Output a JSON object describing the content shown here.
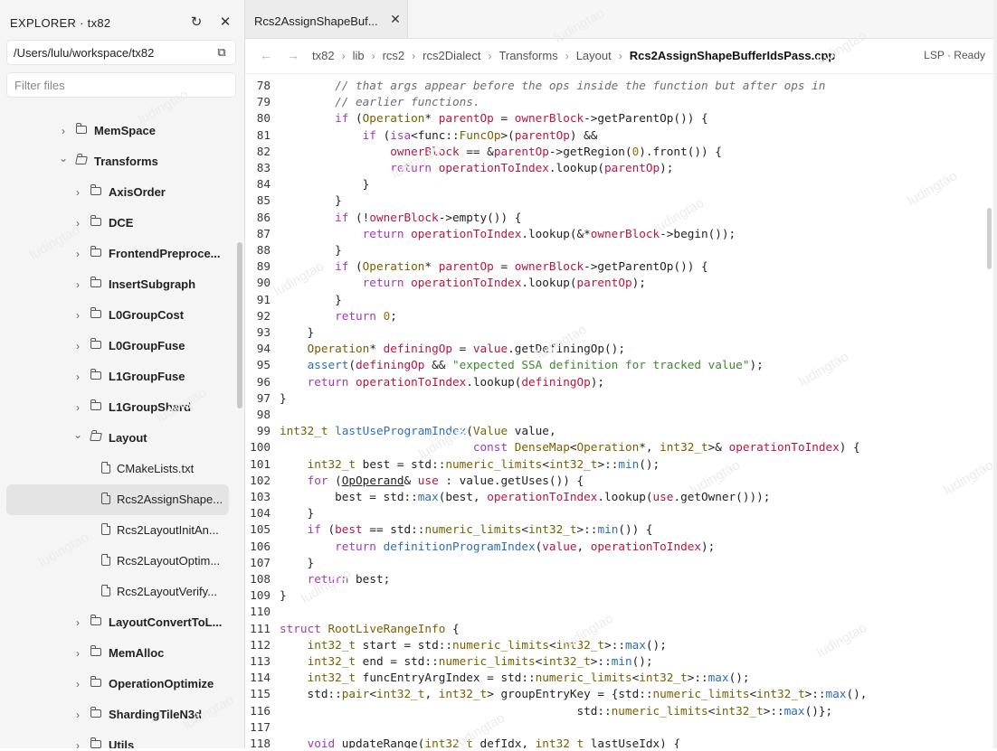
{
  "sidebar": {
    "title": "EXPLORER · tx82",
    "refresh_icon": "refresh-icon",
    "close_icon": "close-icon",
    "path": "/Users/lulu/workspace/tx82",
    "copy_icon": "copy-icon",
    "filter_placeholder": "Filter files",
    "tree": [
      {
        "name": "MemSpace",
        "kind": "folder",
        "expanded": false,
        "bold": true
      },
      {
        "name": "Transforms",
        "kind": "folder",
        "expanded": true,
        "bold": true
      },
      {
        "name": "AxisOrder",
        "kind": "folder",
        "expanded": false,
        "bold": true
      },
      {
        "name": "DCE",
        "kind": "folder",
        "expanded": false,
        "bold": true
      },
      {
        "name": "FrontendPreproce...",
        "kind": "folder",
        "expanded": false,
        "bold": true
      },
      {
        "name": "InsertSubgraph",
        "kind": "folder",
        "expanded": false,
        "bold": true
      },
      {
        "name": "L0GroupCost",
        "kind": "folder",
        "expanded": false,
        "bold": true
      },
      {
        "name": "L0GroupFuse",
        "kind": "folder",
        "expanded": false,
        "bold": true
      },
      {
        "name": "L1GroupFuse",
        "kind": "folder",
        "expanded": false,
        "bold": true
      },
      {
        "name": "L1GroupShard",
        "kind": "folder",
        "expanded": false,
        "bold": true
      },
      {
        "name": "Layout",
        "kind": "folder",
        "expanded": true,
        "bold": true
      },
      {
        "name": "CMakeLists.txt",
        "kind": "file",
        "bold": false
      },
      {
        "name": "Rcs2AssignShape...",
        "kind": "file",
        "bold": false,
        "selected": true
      },
      {
        "name": "Rcs2LayoutInitAn...",
        "kind": "file",
        "bold": false
      },
      {
        "name": "Rcs2LayoutOptim...",
        "kind": "file",
        "bold": false
      },
      {
        "name": "Rcs2LayoutVerify...",
        "kind": "file",
        "bold": false
      },
      {
        "name": "LayoutConvertToL...",
        "kind": "folder",
        "expanded": false,
        "bold": true
      },
      {
        "name": "MemAlloc",
        "kind": "folder",
        "expanded": false,
        "bold": true
      },
      {
        "name": "OperationOptimize",
        "kind": "folder",
        "expanded": false,
        "bold": true
      },
      {
        "name": "ShardingTileN3d",
        "kind": "folder",
        "expanded": false,
        "bold": true
      },
      {
        "name": "Utils",
        "kind": "folder",
        "expanded": false,
        "bold": true
      }
    ]
  },
  "editor": {
    "tab_label": "Rcs2AssignShapeBuf...",
    "tab_close_icon": "close-icon",
    "back_icon": "arrow-left-icon",
    "forward_icon": "arrow-right-icon",
    "breadcrumb": [
      "tx82",
      "lib",
      "rcs2",
      "rcs2Dialect",
      "Transforms",
      "Layout",
      "Rcs2AssignShapeBufferIdsPass.cpp"
    ],
    "lsp_status": "LSP · Ready",
    "lines": [
      {
        "n": "78",
        "s": [
          [
            "        ",
            ""
          ],
          [
            "// that args appear before the ops inside the function but after ops in",
            "cm"
          ]
        ]
      },
      {
        "n": "79",
        "s": [
          [
            "        ",
            ""
          ],
          [
            "// earlier functions.",
            "cm"
          ]
        ]
      },
      {
        "n": "80",
        "s": [
          [
            "        ",
            ""
          ],
          [
            "if",
            "kw"
          ],
          [
            " (",
            ""
          ],
          [
            "Operation",
            "ty"
          ],
          [
            "* ",
            ""
          ],
          [
            "parentOp",
            "id"
          ],
          [
            " = ",
            ""
          ],
          [
            "ownerBlock",
            "id"
          ],
          [
            "->getParentOp()) {",
            ""
          ]
        ]
      },
      {
        "n": "81",
        "s": [
          [
            "            ",
            ""
          ],
          [
            "if",
            "kw"
          ],
          [
            " (",
            ""
          ],
          [
            "isa",
            "kw"
          ],
          [
            "<func::",
            ""
          ],
          [
            "FuncOp",
            "ty"
          ],
          [
            ">(",
            ""
          ],
          [
            "parentOp",
            "id"
          ],
          [
            ") &&",
            ""
          ]
        ]
      },
      {
        "n": "82",
        "s": [
          [
            "                ",
            ""
          ],
          [
            "ownerBlock",
            "id"
          ],
          [
            " == &",
            ""
          ],
          [
            "parentOp",
            "id"
          ],
          [
            "->getRegion(",
            ""
          ],
          [
            "0",
            "nu"
          ],
          [
            ").front()) {",
            ""
          ]
        ]
      },
      {
        "n": "83",
        "s": [
          [
            "                ",
            ""
          ],
          [
            "return",
            "kw"
          ],
          [
            " ",
            ""
          ],
          [
            "operationToIndex",
            "id"
          ],
          [
            ".lookup(",
            ""
          ],
          [
            "parentOp",
            "id"
          ],
          [
            ");",
            ""
          ]
        ]
      },
      {
        "n": "84",
        "s": [
          [
            "            }",
            ""
          ]
        ]
      },
      {
        "n": "85",
        "s": [
          [
            "        }",
            ""
          ]
        ]
      },
      {
        "n": "86",
        "s": [
          [
            "        ",
            ""
          ],
          [
            "if",
            "kw"
          ],
          [
            " (!",
            ""
          ],
          [
            "ownerBlock",
            "id"
          ],
          [
            "->empty()) {",
            ""
          ]
        ]
      },
      {
        "n": "87",
        "s": [
          [
            "            ",
            ""
          ],
          [
            "return",
            "kw"
          ],
          [
            " ",
            ""
          ],
          [
            "operationToIndex",
            "id"
          ],
          [
            ".lookup(&*",
            ""
          ],
          [
            "ownerBlock",
            "id"
          ],
          [
            "->begin());",
            ""
          ]
        ]
      },
      {
        "n": "88",
        "s": [
          [
            "        }",
            ""
          ]
        ]
      },
      {
        "n": "89",
        "s": [
          [
            "        ",
            ""
          ],
          [
            "if",
            "kw"
          ],
          [
            " (",
            ""
          ],
          [
            "Operation",
            "ty"
          ],
          [
            "* ",
            ""
          ],
          [
            "parentOp",
            "id"
          ],
          [
            " = ",
            ""
          ],
          [
            "ownerBlock",
            "id"
          ],
          [
            "->getParentOp()) {",
            ""
          ]
        ]
      },
      {
        "n": "90",
        "s": [
          [
            "            ",
            ""
          ],
          [
            "return",
            "kw"
          ],
          [
            " ",
            ""
          ],
          [
            "operationToIndex",
            "id"
          ],
          [
            ".lookup(",
            ""
          ],
          [
            "parentOp",
            "id"
          ],
          [
            ");",
            ""
          ]
        ]
      },
      {
        "n": "91",
        "s": [
          [
            "        }",
            ""
          ]
        ]
      },
      {
        "n": "92",
        "s": [
          [
            "        ",
            ""
          ],
          [
            "return",
            "kw"
          ],
          [
            " ",
            ""
          ],
          [
            "0",
            "nu"
          ],
          [
            ";",
            ""
          ]
        ]
      },
      {
        "n": "93",
        "s": [
          [
            "    }",
            ""
          ]
        ]
      },
      {
        "n": "94",
        "s": [
          [
            "    ",
            ""
          ],
          [
            "Operation",
            "ty"
          ],
          [
            "* ",
            ""
          ],
          [
            "definingOp",
            "id"
          ],
          [
            " = ",
            ""
          ],
          [
            "value",
            "id"
          ],
          [
            ".getDefiningOp();",
            ""
          ]
        ]
      },
      {
        "n": "95",
        "s": [
          [
            "    ",
            ""
          ],
          [
            "assert",
            "fn"
          ],
          [
            "(",
            ""
          ],
          [
            "definingOp",
            "id"
          ],
          [
            " && ",
            ""
          ],
          [
            "\"expected SSA definition for tracked value\"",
            "st"
          ],
          [
            ");",
            ""
          ]
        ]
      },
      {
        "n": "96",
        "s": [
          [
            "    ",
            ""
          ],
          [
            "return",
            "kw"
          ],
          [
            " ",
            ""
          ],
          [
            "operationToIndex",
            "id"
          ],
          [
            ".lookup(",
            ""
          ],
          [
            "definingOp",
            "id"
          ],
          [
            ");",
            ""
          ]
        ]
      },
      {
        "n": "97",
        "s": [
          [
            "}",
            ""
          ]
        ]
      },
      {
        "n": "98",
        "s": []
      },
      {
        "n": "99",
        "s": [
          [
            "int32_t",
            "ty"
          ],
          [
            " ",
            ""
          ],
          [
            "lastUseProgramIndex",
            "fn"
          ],
          [
            "(",
            ""
          ],
          [
            "Value",
            "ty"
          ],
          [
            " value,",
            ""
          ]
        ]
      },
      {
        "n": "100",
        "s": [
          [
            "                            ",
            ""
          ],
          [
            "const",
            "kw"
          ],
          [
            " ",
            ""
          ],
          [
            "DenseMap",
            "ty"
          ],
          [
            "<",
            ""
          ],
          [
            "Operation",
            "ty"
          ],
          [
            "*, ",
            ""
          ],
          [
            "int32_t",
            "ty"
          ],
          [
            ">& ",
            ""
          ],
          [
            "operationToIndex",
            "id"
          ],
          [
            ") {",
            ""
          ]
        ]
      },
      {
        "n": "101",
        "s": [
          [
            "    ",
            ""
          ],
          [
            "int32_t",
            "ty"
          ],
          [
            " best = std::",
            ""
          ],
          [
            "numeric_limits",
            "ty"
          ],
          [
            "<",
            ""
          ],
          [
            "int32_t",
            "ty"
          ],
          [
            ">::",
            ""
          ],
          [
            "min",
            "fn"
          ],
          [
            "();",
            ""
          ]
        ]
      },
      {
        "n": "102",
        "s": [
          [
            "    ",
            ""
          ],
          [
            "for",
            "kw"
          ],
          [
            " (",
            ""
          ],
          [
            "OpOperand",
            "un"
          ],
          [
            "& ",
            ""
          ],
          [
            "use",
            "id"
          ],
          [
            " : value.getUses()) {",
            ""
          ]
        ]
      },
      {
        "n": "103",
        "s": [
          [
            "        best = std::",
            ""
          ],
          [
            "max",
            "fn"
          ],
          [
            "(best, ",
            ""
          ],
          [
            "operationToIndex",
            "id"
          ],
          [
            ".lookup(",
            ""
          ],
          [
            "use",
            "id"
          ],
          [
            ".getOwner()));",
            ""
          ]
        ]
      },
      {
        "n": "104",
        "s": [
          [
            "    }",
            ""
          ]
        ]
      },
      {
        "n": "105",
        "s": [
          [
            "    ",
            ""
          ],
          [
            "if",
            "kw"
          ],
          [
            " (",
            ""
          ],
          [
            "best",
            "id"
          ],
          [
            " == std::",
            ""
          ],
          [
            "numeric_limits",
            "ty"
          ],
          [
            "<",
            ""
          ],
          [
            "int32_t",
            "ty"
          ],
          [
            ">::",
            ""
          ],
          [
            "min",
            "fn"
          ],
          [
            "()) {",
            ""
          ]
        ]
      },
      {
        "n": "106",
        "s": [
          [
            "        ",
            ""
          ],
          [
            "return",
            "kw"
          ],
          [
            " ",
            ""
          ],
          [
            "definitionProgramIndex",
            "fn"
          ],
          [
            "(",
            ""
          ],
          [
            "value",
            "id"
          ],
          [
            ", ",
            ""
          ],
          [
            "operationToIndex",
            "id"
          ],
          [
            ");",
            ""
          ]
        ]
      },
      {
        "n": "107",
        "s": [
          [
            "    }",
            ""
          ]
        ]
      },
      {
        "n": "108",
        "s": [
          [
            "    ",
            ""
          ],
          [
            "return",
            "kw"
          ],
          [
            " best;",
            ""
          ]
        ]
      },
      {
        "n": "109",
        "s": [
          [
            "}",
            ""
          ]
        ]
      },
      {
        "n": "110",
        "s": []
      },
      {
        "n": "111",
        "s": [
          [
            "struct",
            "kw"
          ],
          [
            " ",
            ""
          ],
          [
            "RootLiveRangeInfo",
            "ty"
          ],
          [
            " {",
            ""
          ]
        ]
      },
      {
        "n": "112",
        "s": [
          [
            "    ",
            ""
          ],
          [
            "int32_t",
            "ty"
          ],
          [
            " start = std::",
            ""
          ],
          [
            "numeric_limits",
            "ty"
          ],
          [
            "<",
            ""
          ],
          [
            "int32_t",
            "ty"
          ],
          [
            ">::",
            ""
          ],
          [
            "max",
            "fn"
          ],
          [
            "();",
            ""
          ]
        ]
      },
      {
        "n": "113",
        "s": [
          [
            "    ",
            ""
          ],
          [
            "int32_t",
            "ty"
          ],
          [
            " end = std::",
            ""
          ],
          [
            "numeric_limits",
            "ty"
          ],
          [
            "<",
            ""
          ],
          [
            "int32_t",
            "ty"
          ],
          [
            ">::",
            ""
          ],
          [
            "min",
            "fn"
          ],
          [
            "();",
            ""
          ]
        ]
      },
      {
        "n": "114",
        "s": [
          [
            "    ",
            ""
          ],
          [
            "int32_t",
            "ty"
          ],
          [
            " funcEntryArgIndex = std::",
            ""
          ],
          [
            "numeric_limits",
            "ty"
          ],
          [
            "<",
            ""
          ],
          [
            "int32_t",
            "ty"
          ],
          [
            ">::",
            ""
          ],
          [
            "max",
            "fn"
          ],
          [
            "();",
            ""
          ]
        ]
      },
      {
        "n": "115",
        "s": [
          [
            "    std::",
            ""
          ],
          [
            "pair",
            "ty"
          ],
          [
            "<",
            ""
          ],
          [
            "int32_t",
            "ty"
          ],
          [
            ", ",
            ""
          ],
          [
            "int32_t",
            "ty"
          ],
          [
            "> groupEntryKey = {std::",
            ""
          ],
          [
            "numeric_limits",
            "ty"
          ],
          [
            "<",
            ""
          ],
          [
            "int32_t",
            "ty"
          ],
          [
            ">::",
            ""
          ],
          [
            "max",
            "fn"
          ],
          [
            "(),",
            ""
          ]
        ]
      },
      {
        "n": "116",
        "s": [
          [
            "                                           std::",
            ""
          ],
          [
            "numeric_limits",
            "ty"
          ],
          [
            "<",
            ""
          ],
          [
            "int32_t",
            "ty"
          ],
          [
            ">::",
            ""
          ],
          [
            "max",
            "fn"
          ],
          [
            "()};",
            ""
          ]
        ]
      },
      {
        "n": "117",
        "s": []
      },
      {
        "n": "118",
        "s": [
          [
            "    ",
            ""
          ],
          [
            "void",
            "kw"
          ],
          [
            " updateRange(",
            ""
          ],
          [
            "int32_t",
            "ty"
          ],
          [
            " defIdx, ",
            ""
          ],
          [
            "int32_t",
            "ty"
          ],
          [
            " lastUseIdx) {",
            ""
          ]
        ]
      }
    ]
  },
  "watermark_text": "ludingtao",
  "colors": {
    "keyword": "#a23ab4",
    "type": "#7a6000",
    "function": "#2d6fb3",
    "identifier": "#b81642",
    "comment": "#6e6e6e",
    "string": "#3b8a2c",
    "number": "#a36c00",
    "selection": "#e4e4e4"
  }
}
